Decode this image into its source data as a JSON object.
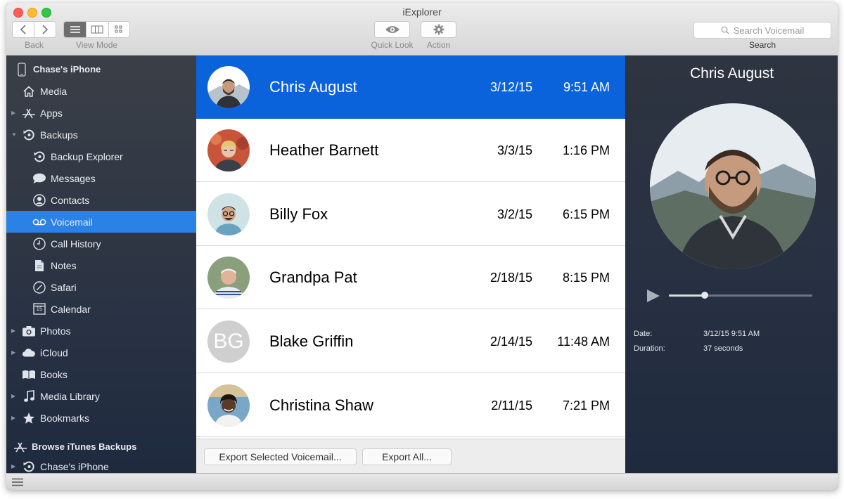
{
  "window": {
    "title": "iExplorer"
  },
  "toolbar": {
    "back_label": "Back",
    "view_mode_label": "View Mode",
    "quick_look_label": "Quick Look",
    "action_label": "Action",
    "search_placeholder": "Search Voicemail",
    "search_label": "Search"
  },
  "sidebar": {
    "device": "Chase's iPhone",
    "items": [
      {
        "label": "Media",
        "icon": "house-icon"
      },
      {
        "label": "Apps",
        "icon": "app-store-icon"
      },
      {
        "label": "Backups",
        "icon": "backup-icon"
      },
      {
        "label": "Backup Explorer",
        "icon": "backup-icon"
      },
      {
        "label": "Messages",
        "icon": "speech-bubble-icon"
      },
      {
        "label": "Contacts",
        "icon": "contact-icon"
      },
      {
        "label": "Voicemail",
        "icon": "voicemail-icon"
      },
      {
        "label": "Call History",
        "icon": "clock-icon"
      },
      {
        "label": "Notes",
        "icon": "note-icon"
      },
      {
        "label": "Safari",
        "icon": "compass-icon"
      },
      {
        "label": "Calendar",
        "icon": "calendar-icon",
        "badge": "15"
      },
      {
        "label": "Photos",
        "icon": "camera-icon"
      },
      {
        "label": "iCloud",
        "icon": "cloud-icon"
      },
      {
        "label": "Books",
        "icon": "book-icon"
      },
      {
        "label": "Media Library",
        "icon": "music-note-icon"
      },
      {
        "label": "Bookmarks",
        "icon": "star-icon"
      }
    ],
    "browse_header": "Browse iTunes Backups",
    "backup_device": "Chase's iPhone"
  },
  "voicemails": [
    {
      "name": "Chris August",
      "date": "3/12/15",
      "time": "9:51 AM"
    },
    {
      "name": "Heather Barnett",
      "date": "3/3/15",
      "time": "1:16 PM"
    },
    {
      "name": "Billy Fox",
      "date": "3/2/15",
      "time": "6:15 PM"
    },
    {
      "name": "Grandpa Pat",
      "date": "2/18/15",
      "time": "8:15 PM"
    },
    {
      "name": "Blake Griffin",
      "date": "2/14/15",
      "time": "11:48 AM",
      "initials": "BG"
    },
    {
      "name": "Christina Shaw",
      "date": "2/11/15",
      "time": "7:21 PM"
    }
  ],
  "footer": {
    "export_selected": "Export Selected Voicemail...",
    "export_all": "Export All..."
  },
  "detail": {
    "name": "Chris August",
    "playback_progress": 0.25,
    "date_key": "Date:",
    "date_val": "3/12/15 9:51 AM",
    "duration_key": "Duration:",
    "duration_val": "37 seconds"
  },
  "colors": {
    "selection_blue": "#0b63dc",
    "sidebar_selection": "#2a82e6"
  }
}
